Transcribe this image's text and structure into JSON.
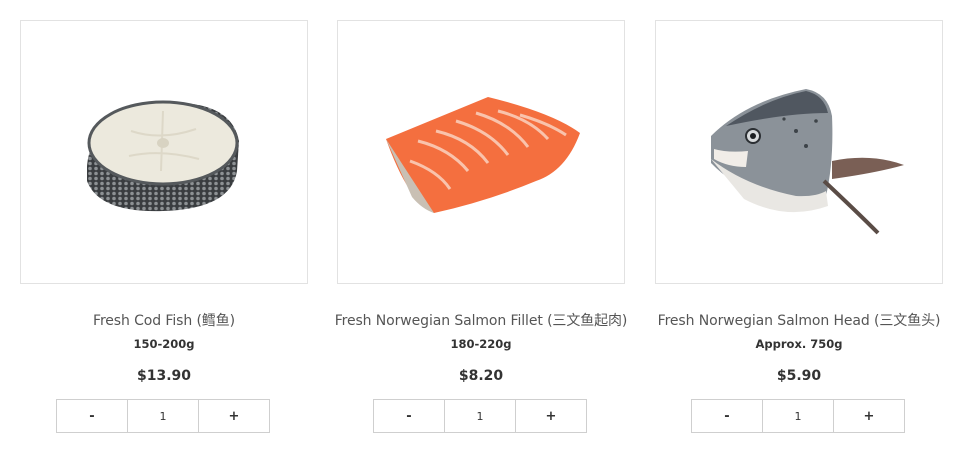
{
  "products": [
    {
      "name": "Fresh Cod Fish (鳕鱼)",
      "weight": "150-200g",
      "price": "$13.90",
      "qty": {
        "minus": "-",
        "value": "1",
        "plus": "+"
      }
    },
    {
      "name": "Fresh Norwegian Salmon Fillet (三文鱼起肉)",
      "weight": "180-220g",
      "price": "$8.20",
      "qty": {
        "minus": "-",
        "value": "1",
        "plus": "+"
      }
    },
    {
      "name": "Fresh Norwegian Salmon Head (三文鱼头)",
      "weight": "Approx. 750g",
      "price": "$5.90",
      "qty": {
        "minus": "-",
        "value": "1",
        "plus": "+"
      }
    }
  ]
}
